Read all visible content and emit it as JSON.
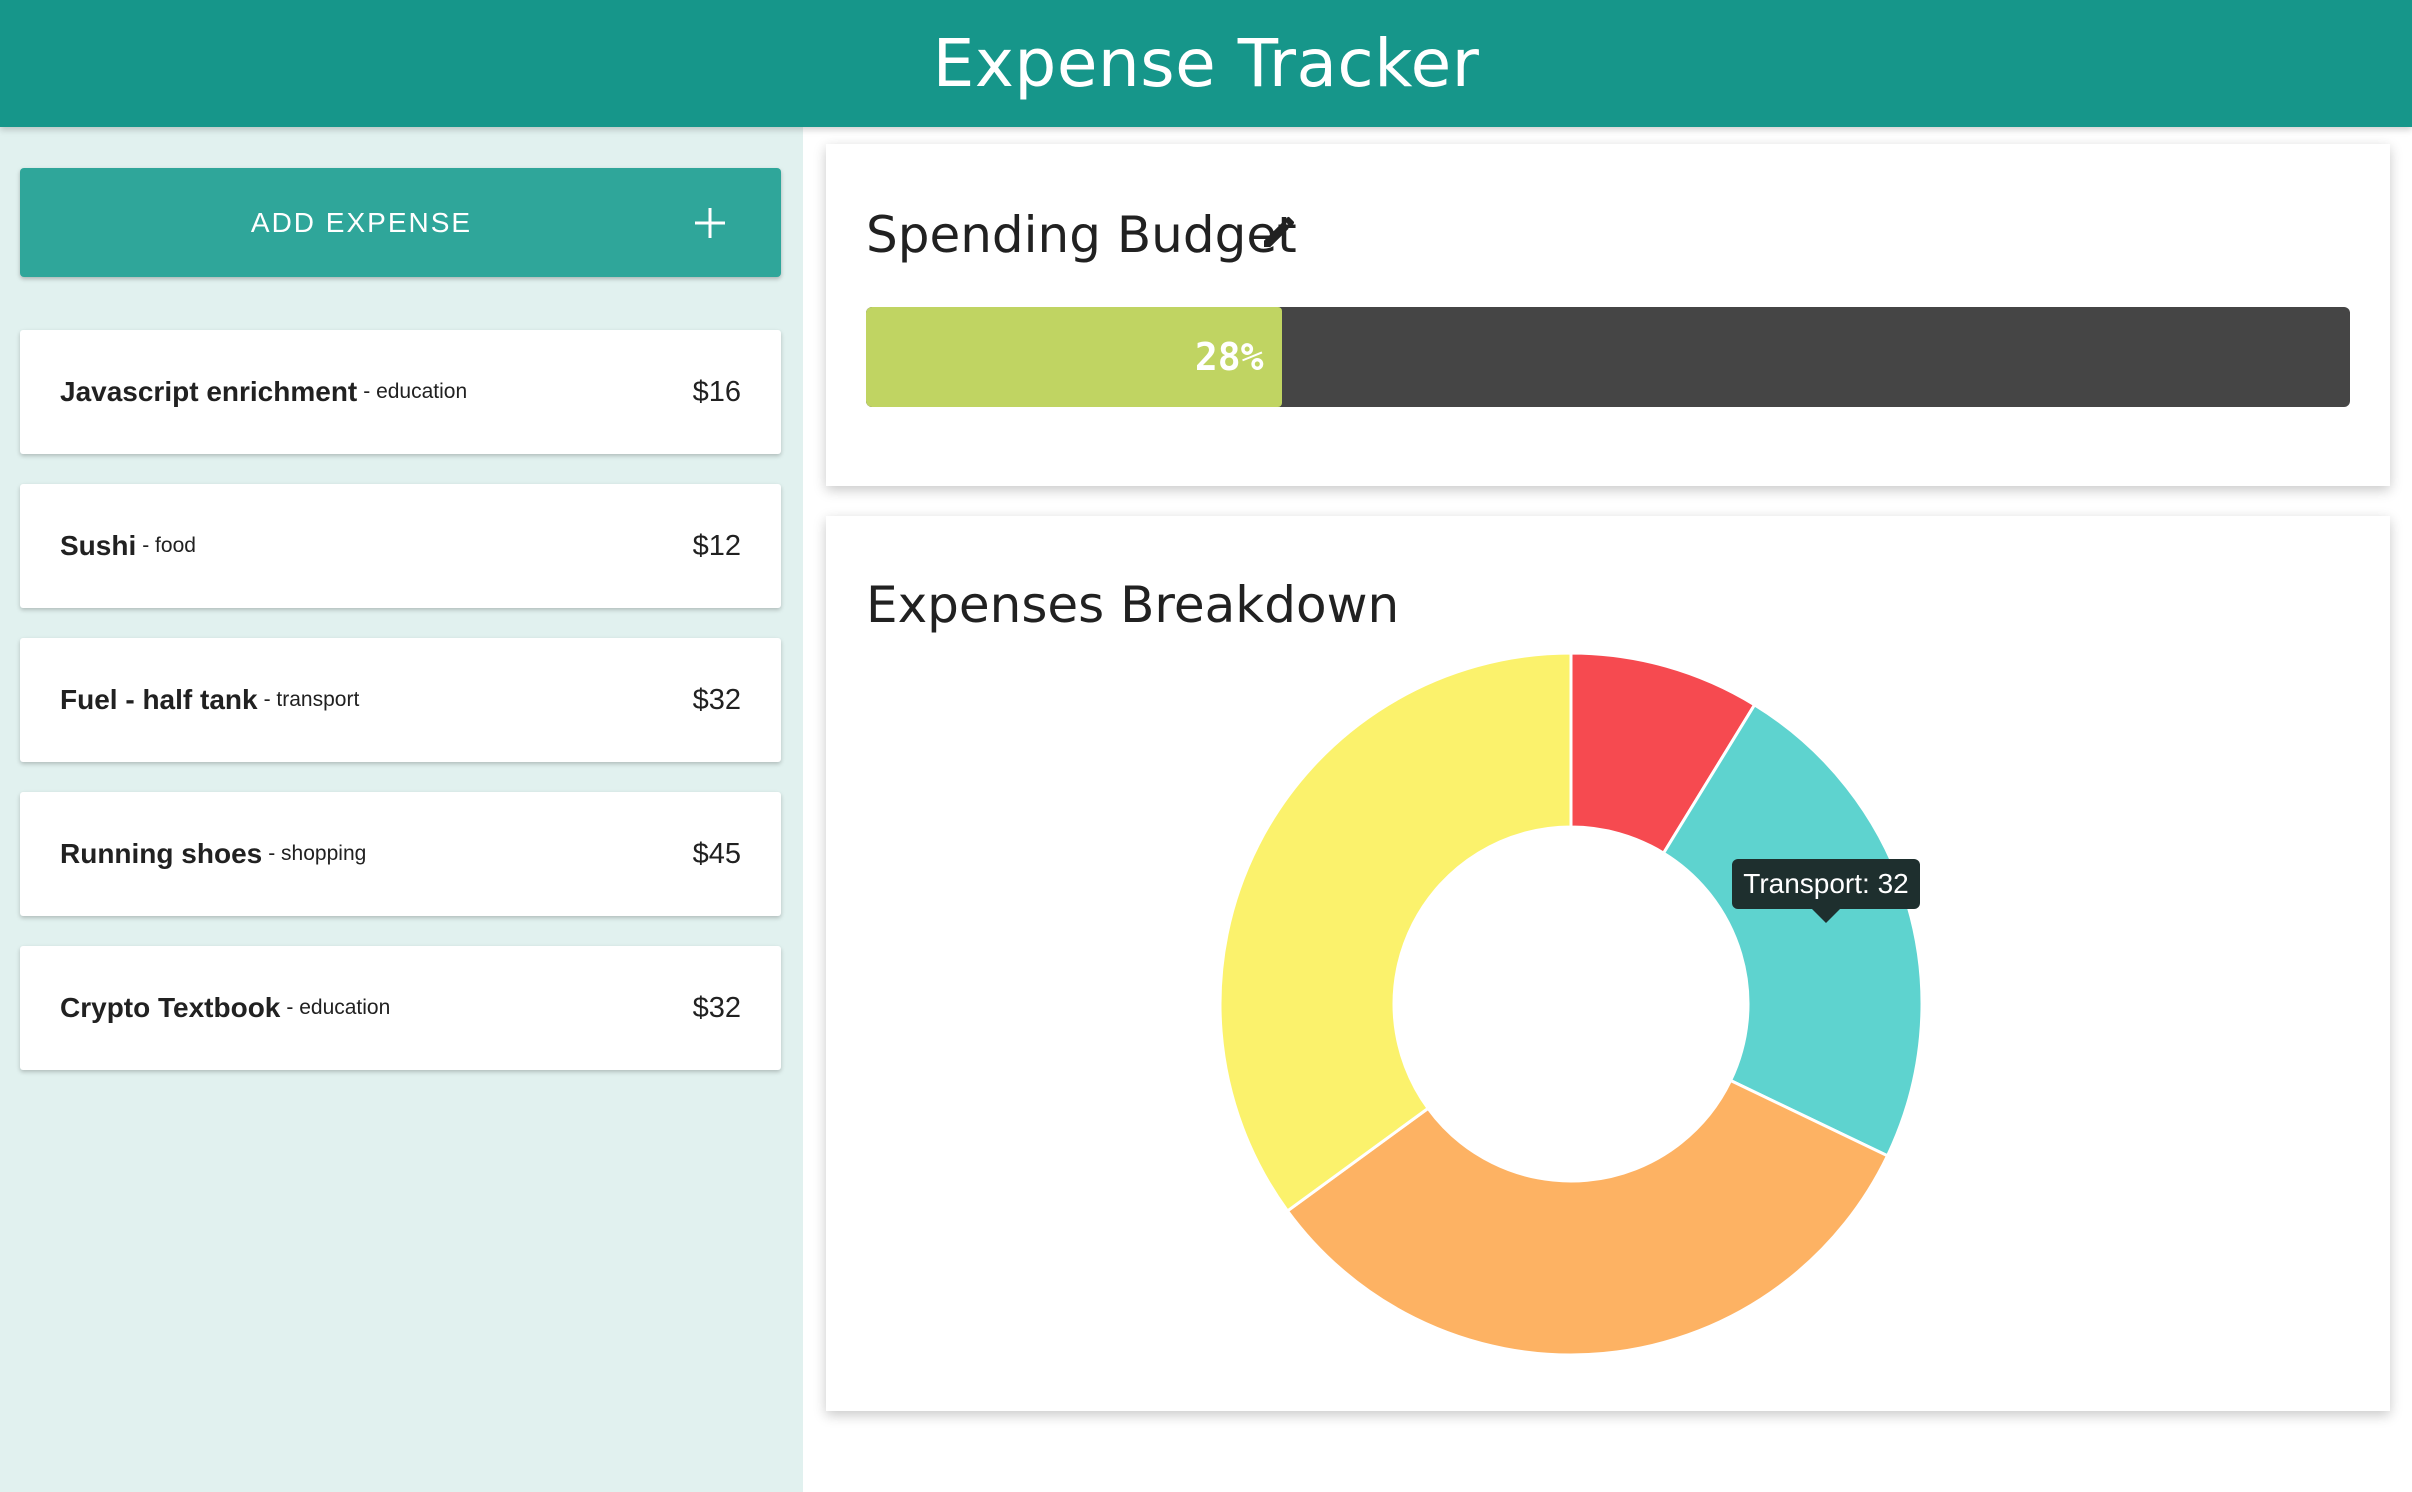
{
  "app": {
    "title": "Expense Tracker"
  },
  "sidebar": {
    "add_button": {
      "label": "ADD EXPENSE",
      "icon": "plus-icon"
    },
    "expenses": [
      {
        "name": "Javascript enrichment",
        "category": "- education",
        "amount": "$16"
      },
      {
        "name": "Sushi",
        "category": "- food",
        "amount": "$12"
      },
      {
        "name": "Fuel - half tank",
        "category": "- transport",
        "amount": "$32"
      },
      {
        "name": "Running shoes",
        "category": "- shopping",
        "amount": "$45"
      },
      {
        "name": "Crypto Textbook",
        "category": "- education",
        "amount": "$32"
      }
    ]
  },
  "budget": {
    "title": "Spending Budget",
    "edit_icon": "pencil-icon",
    "percent_label": "28%",
    "percent_value": 28
  },
  "breakdown": {
    "title": "Expenses Breakdown",
    "tooltip": "Transport: 32"
  },
  "chart_data": {
    "type": "pie",
    "variant": "doughnut",
    "categories": [
      "Food",
      "Transport",
      "Shopping",
      "Education"
    ],
    "values": [
      12,
      32,
      45,
      48
    ],
    "colors": [
      "#f64a50",
      "#5ed3cf",
      "#fdb263",
      "#fbf26c"
    ],
    "legend": "none"
  },
  "colors": {
    "header": "#16968a",
    "add_button": "#2fa69a",
    "sidebar_bg": "#e1f1ef",
    "progress_fill": "#c0d462",
    "progress_track": "#454545"
  }
}
